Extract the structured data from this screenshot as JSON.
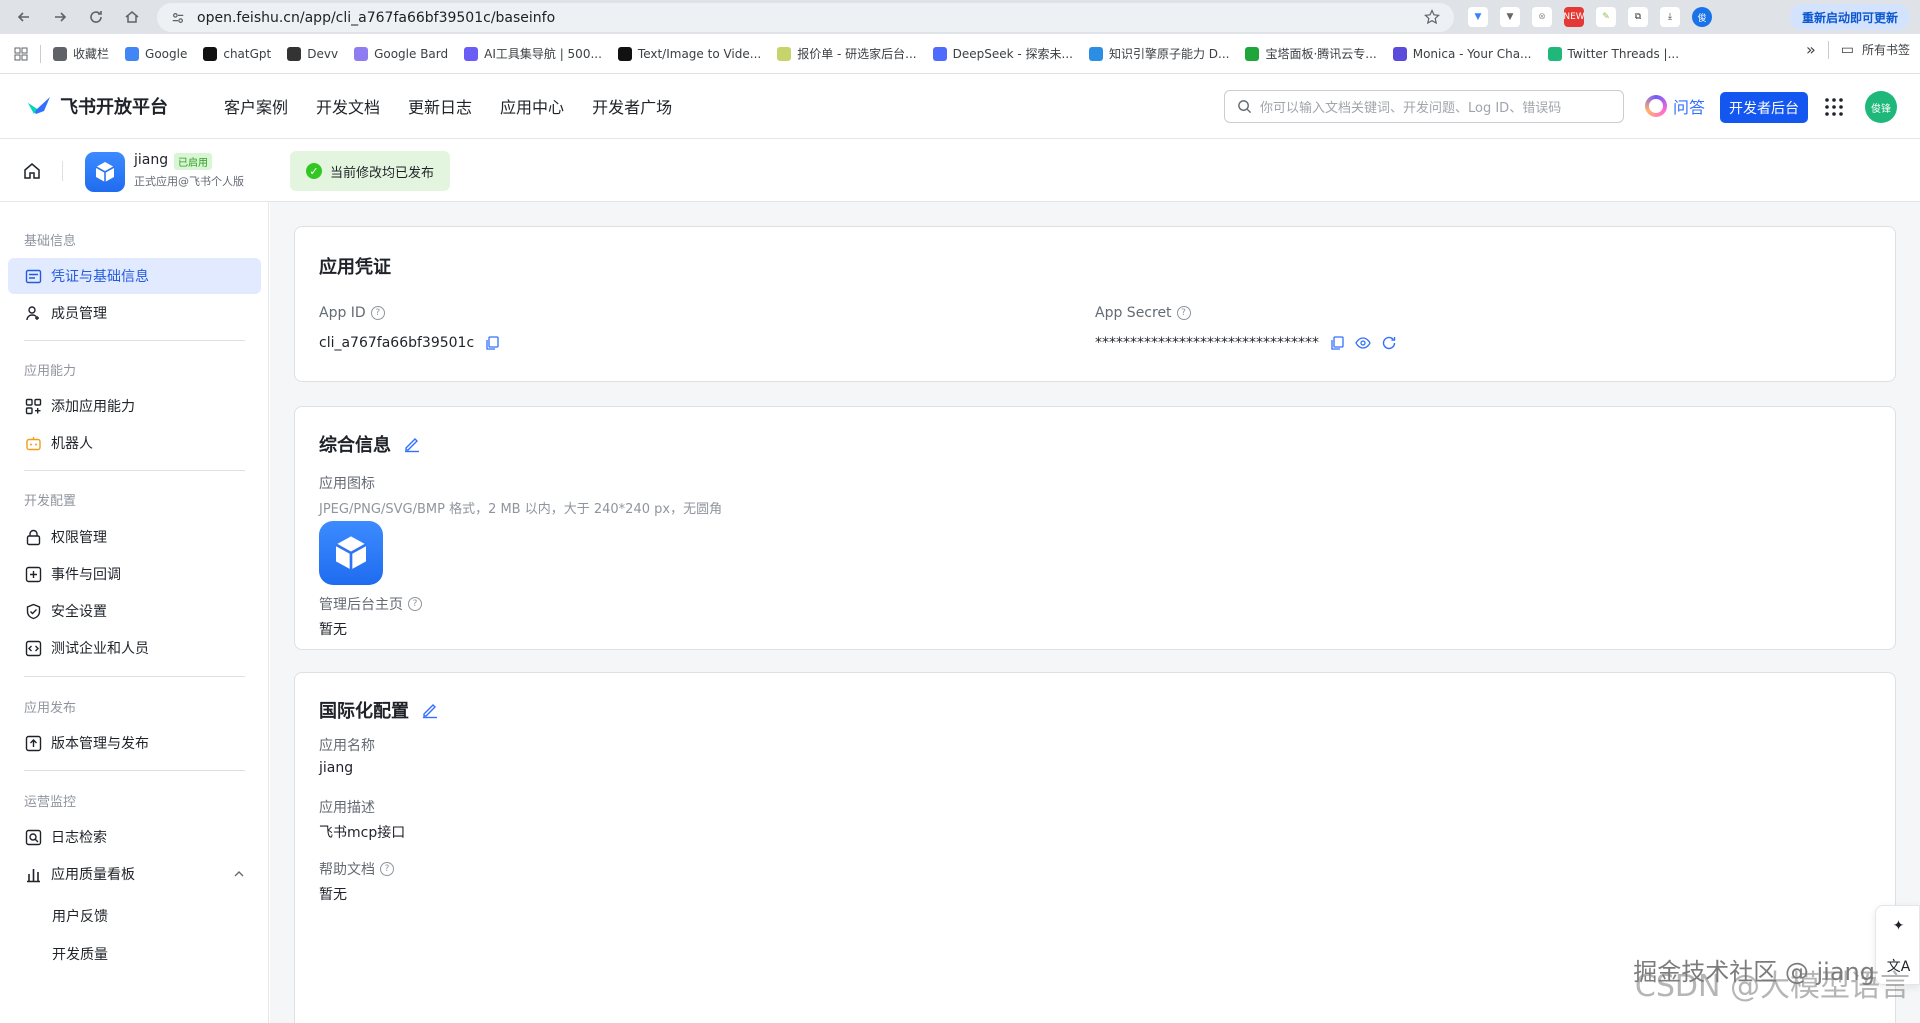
{
  "browser": {
    "url": "open.feishu.cn/app/cli_a767fa66bf39501c/baseinfo",
    "update_button": "重新启动即可更新",
    "bookmarks": [
      {
        "label": "收藏栏",
        "color": "#5f6368"
      },
      {
        "label": "Google",
        "color": "#4285f4"
      },
      {
        "label": "chatGpt",
        "color": "#111111"
      },
      {
        "label": "Devv",
        "color": "#333333"
      },
      {
        "label": "Google Bard",
        "color": "#8e7cf0"
      },
      {
        "label": "AI工具集导航 | 500...",
        "color": "#6a5cf5"
      },
      {
        "label": "Text/Image to Vide...",
        "color": "#111111"
      },
      {
        "label": "报价单 - 研选家后台...",
        "color": "#c7d36b"
      },
      {
        "label": "DeepSeek - 探索未...",
        "color": "#4d6bfe"
      },
      {
        "label": "知识引擎原子能力 D...",
        "color": "#2b8de3"
      },
      {
        "label": "宝塔面板·腾讯云专...",
        "color": "#20a53a"
      },
      {
        "label": "Monica - Your Cha...",
        "color": "#5b4bdb"
      },
      {
        "label": "Twitter Threads |...",
        "color": "#1fb87a"
      }
    ],
    "bookmarks_more": "»",
    "all_bookmarks": "所有书签"
  },
  "header": {
    "brand": "飞书开放平台",
    "nav": [
      "客户案例",
      "开发文档",
      "更新日志",
      "应用中心",
      "开发者广场"
    ],
    "search_placeholder": "你可以输入文档关键词、开发问题、Log ID、错误码",
    "qa_label": "问答",
    "dev_console": "开发者后台",
    "avatar_text": "俊锋"
  },
  "subheader": {
    "app_name": "jiang",
    "app_status": "已启用",
    "app_subtitle": "正式应用@飞书个人版",
    "publish_status": "当前修改均已发布"
  },
  "sidebar": {
    "groups": [
      {
        "title": "基础信息",
        "items": [
          "凭证与基础信息",
          "成员管理"
        ]
      },
      {
        "title": "应用能力",
        "items": [
          "添加应用能力",
          "机器人"
        ]
      },
      {
        "title": "开发配置",
        "items": [
          "权限管理",
          "事件与回调",
          "安全设置",
          "测试企业和人员"
        ]
      },
      {
        "title": "应用发布",
        "items": [
          "版本管理与发布"
        ]
      },
      {
        "title": "运营监控",
        "items": [
          "日志检索",
          "应用质量看板"
        ]
      }
    ],
    "quality_subitems": [
      "用户反馈",
      "开发质量"
    ]
  },
  "credentials": {
    "title": "应用凭证",
    "app_id_label": "App ID",
    "app_id_value": "cli_a767fa66bf39501c",
    "app_secret_label": "App Secret",
    "app_secret_value": "********************************"
  },
  "general": {
    "title": "综合信息",
    "icon_label": "应用图标",
    "icon_hint": "JPEG/PNG/SVG/BMP 格式，2 MB 以内，大于 240*240 px，无圆角",
    "home_label": "管理后台主页",
    "home_value": "暂无"
  },
  "i18n": {
    "title": "国际化配置",
    "name_label": "应用名称",
    "name_value": "jiang",
    "desc_label": "应用描述",
    "desc_value": "飞书mcp接口",
    "help_label": "帮助文档",
    "help_value": "暂无"
  },
  "watermark": {
    "line1": "掘金技术社区 @ jiang",
    "line2": "CSDN @大模型语言"
  },
  "colors": {
    "accent": "#3370ff",
    "active_bg": "#e1eaff",
    "success": "#34c724"
  }
}
